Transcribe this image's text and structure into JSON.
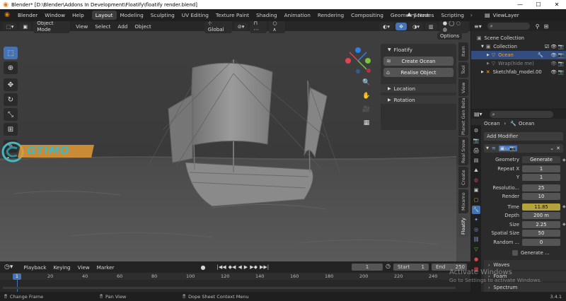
{
  "window": {
    "title": "Blender* [D:\\Blender\\Addons In Development\\Floatify\\floatify render.blend]",
    "controls": [
      "—",
      "☐",
      "✕"
    ]
  },
  "menubar": {
    "items": [
      "Blender",
      "Window",
      "Help"
    ],
    "workspaces": [
      "Layout",
      "Modeling",
      "Sculpting",
      "UV Editing",
      "Texture Paint",
      "Shading",
      "Animation",
      "Rendering",
      "Compositing",
      "Geometry Nodes",
      "Scripting"
    ],
    "active_workspace": "Layout",
    "scene": "Scene",
    "view_layer": "ViewLayer"
  },
  "viewport": {
    "mode": "Object Mode",
    "menus": [
      "View",
      "Select",
      "Add",
      "Object"
    ],
    "orientation": "Global",
    "options_label": "Options",
    "tabs": [
      "Item",
      "Tool",
      "View",
      "Planet Gen Beta",
      "Real Snow",
      "Create",
      "Mixamo",
      "Floatify"
    ],
    "active_tab": "Floatify"
  },
  "floatify_panel": {
    "title": "Floatify",
    "buttons": [
      "Create Ocean",
      "Realise Object"
    ],
    "sections": [
      "Location",
      "Rotation"
    ]
  },
  "watermark": {
    "text": "GTIMO"
  },
  "timeline": {
    "menus": [
      "Playback",
      "Keying",
      "View",
      "Marker"
    ],
    "current_frame": "1",
    "start_label": "Start",
    "start": "1",
    "end_label": "End",
    "end": "250",
    "ticks": [
      "0",
      "20",
      "40",
      "60",
      "80",
      "100",
      "120",
      "140",
      "160",
      "180",
      "200",
      "220",
      "240"
    ],
    "playhead": "1"
  },
  "status": {
    "items": [
      "Change Frame",
      "Pan View",
      "Dope Sheet Context Menu"
    ],
    "version": "3.4.1"
  },
  "outliner": {
    "rows": [
      {
        "label": "Scene Collection",
        "indent": 0
      },
      {
        "label": "Collection",
        "indent": 1
      },
      {
        "label": "Ocean",
        "indent": 2
      },
      {
        "label": "Wrap(hide me)",
        "indent": 2
      },
      {
        "label": "Sketchfab_model.00",
        "indent": 1
      }
    ]
  },
  "properties": {
    "breadcrumb": [
      "Ocean",
      "Ocean"
    ],
    "add_modifier": "Add Modifier",
    "fields": [
      {
        "label": "Geometry",
        "value": "Generate"
      },
      {
        "label": "Repeat X",
        "value": "1"
      },
      {
        "label": "Y",
        "value": "1"
      },
      {
        "label": "Resolutio...",
        "value": "25"
      },
      {
        "label": "Render",
        "value": "10"
      },
      {
        "label": "Time",
        "value": "11.85"
      },
      {
        "label": "Depth",
        "value": "200 m"
      },
      {
        "label": "Size",
        "value": "2.25"
      },
      {
        "label": "Spatial Size",
        "value": "50"
      },
      {
        "label": "Random ...",
        "value": "0"
      }
    ],
    "checkbox_label": "Generate ...",
    "subpanels": [
      "Waves",
      "Foam",
      "Spectrum"
    ]
  },
  "activation": {
    "line1": "Activate Windows",
    "line2": "Go to Settings to activate Windows."
  },
  "colors": {
    "accent_blue": "#4772b3",
    "time_highlight": "#b5a23a",
    "orange": "#e87d0d"
  }
}
